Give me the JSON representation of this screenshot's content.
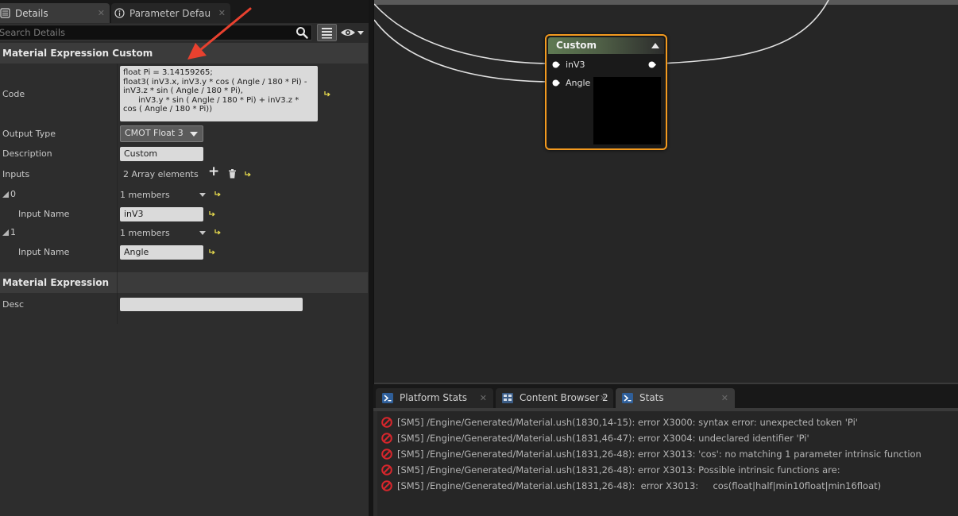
{
  "details_panel": {
    "tabs": [
      {
        "label": "Details",
        "icon": "details-icon",
        "close": "✕"
      },
      {
        "label": "Parameter Defaults",
        "icon": "info-icon",
        "close": "✕"
      }
    ],
    "search": {
      "placeholder": "Search Details",
      "value": ""
    },
    "categories": {
      "custom": "Material Expression Custom",
      "expression": "Material Expression"
    },
    "properties": {
      "code_label": "Code",
      "code_value": "float Pi = 3.14159265;\nfloat3( inV3.x, inV3.y * cos ( Angle / 180 * Pi) - inV3.z * sin ( Angle / 180 * Pi),\n      inV3.y * sin ( Angle / 180 * Pi) + inV3.z * cos ( Angle / 180 * Pi))",
      "output_type_label": "Output Type",
      "output_type_value": "CMOT Float 3",
      "description_label": "Description",
      "description_value": "Custom",
      "inputs_label": "Inputs",
      "inputs_count": "2 Array elements",
      "add_symbol": "+",
      "input_0": {
        "index": "0",
        "members": "1 members",
        "name_label": "Input Name",
        "name_value": "inV3"
      },
      "input_1": {
        "index": "1",
        "members": "1 members",
        "name_label": "Input Name",
        "name_value": "Angle"
      },
      "desc_label": "Desc",
      "desc_value": ""
    }
  },
  "graph": {
    "node": {
      "title": "Custom",
      "inputs": [
        "inV3",
        "Angle"
      ],
      "header_color": "#5f7a53",
      "border_color": "#f39a1f"
    }
  },
  "message_log": {
    "tabs": [
      {
        "label": "Platform Stats",
        "close": "✕"
      },
      {
        "label": "Content Browser 2",
        "close": "✕"
      },
      {
        "label": "Stats",
        "close": "✕"
      }
    ],
    "errors": [
      "[SM5] /Engine/Generated/Material.ush(1830,14-15):  error X3000: syntax error: unexpected token 'Pi'",
      "[SM5] /Engine/Generated/Material.ush(1831,46-47):  error X3004: undeclared identifier 'Pi'",
      "[SM5] /Engine/Generated/Material.ush(1831,26-48):  error X3013: 'cos': no matching 1 parameter intrinsic function",
      "[SM5] /Engine/Generated/Material.ush(1831,26-48):  error X3013: Possible intrinsic functions are:",
      "[SM5] /Engine/Generated/Material.ush(1831,26-48):  error X3013:     cos(float|half|min10float|min16float)"
    ],
    "error_color": "#d8262c"
  },
  "annotation": {
    "color": "#e8412f"
  }
}
